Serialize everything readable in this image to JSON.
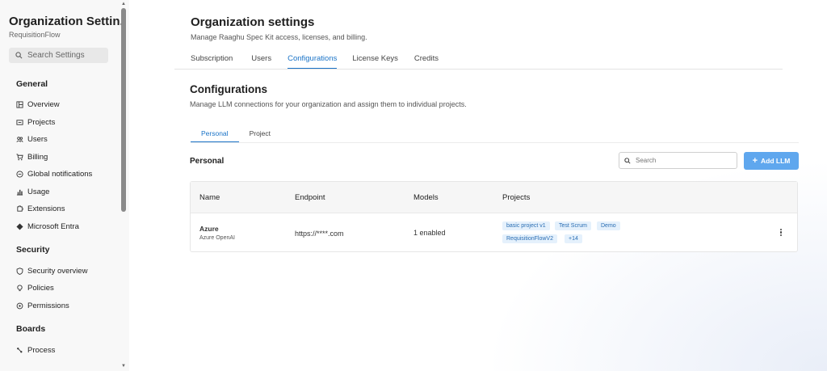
{
  "sidebar": {
    "title": "Organization Settin...",
    "subtitle": "RequisitionFlow",
    "search_placeholder": "Search Settings",
    "sections": {
      "general": "General",
      "security": "Security",
      "boards": "Boards"
    },
    "general_items": [
      "Overview",
      "Projects",
      "Users",
      "Billing",
      "Global notifications",
      "Usage",
      "Extensions",
      "Microsoft Entra"
    ],
    "security_items": [
      "Security overview",
      "Policies",
      "Permissions"
    ],
    "boards_items": [
      "Process"
    ]
  },
  "header": {
    "title": "Organization settings",
    "subtitle": "Manage Raaghu Spec Kit access, licenses, and billing.",
    "tabs": [
      "Subscription",
      "Users",
      "Configurations",
      "License Keys",
      "Credits"
    ],
    "active_tab": "Configurations"
  },
  "configurations": {
    "title": "Configurations",
    "subtitle": "Manage LLM connections for your organization and assign them to individual projects.",
    "subtabs": [
      "Personal",
      "Project"
    ],
    "active_subtab": "Personal",
    "section_label": "Personal",
    "search_placeholder": "Search",
    "add_button": "Add LLM"
  },
  "table": {
    "columns": [
      "Name",
      "Endpoint",
      "Models",
      "Projects"
    ],
    "rows": [
      {
        "name": "Azure",
        "provider": "Azure OpenAI",
        "endpoint": "https://****.com",
        "models": "1 enabled",
        "projects": [
          "basic project v1",
          "Test Scrum",
          "Demo",
          "RequisitionFlowV2",
          "+14"
        ]
      }
    ]
  },
  "colors": {
    "accent": "#1a73c7",
    "button": "#5fa7ee",
    "chip_bg": "#e5f1fc"
  }
}
